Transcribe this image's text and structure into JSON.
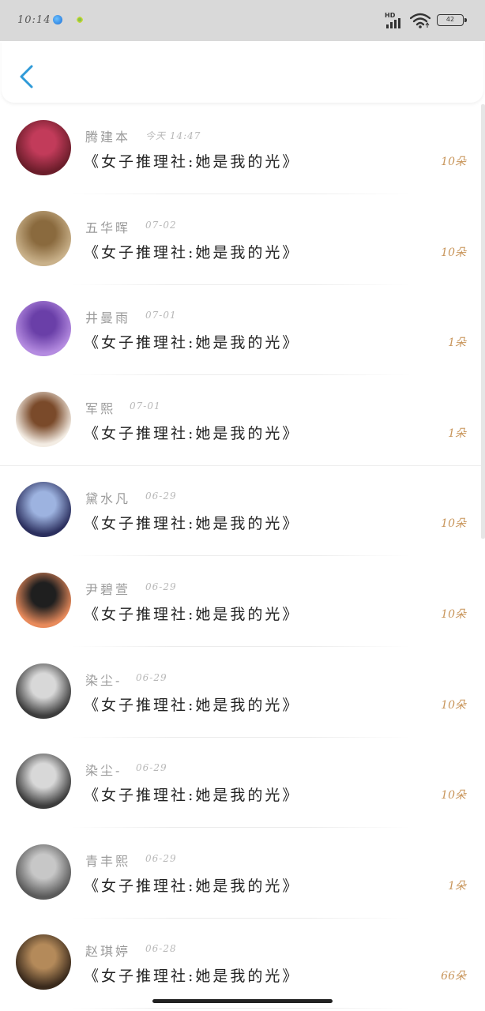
{
  "status_bar": {
    "time": "10:14",
    "network": "HD",
    "battery": "42"
  },
  "gifts": [
    {
      "user": "腾建本",
      "date": "今天 14:47",
      "title": "《女子推理社:她是我的光》",
      "count": "10朵",
      "avatar_colors": [
        "#6b1d2a",
        "#c23b5a"
      ]
    },
    {
      "user": "五华晖",
      "date": "07-02",
      "title": "《女子推理社:她是我的光》",
      "count": "10朵",
      "avatar_colors": [
        "#c9b18a",
        "#8a6a3e"
      ]
    },
    {
      "user": "井曼雨",
      "date": "07-01",
      "title": "《女子推理社:她是我的光》",
      "count": "1朵",
      "avatar_colors": [
        "#b48be0",
        "#6a3fa8"
      ]
    },
    {
      "user": "军熙",
      "date": "07-01",
      "title": "《女子推理社:她是我的光》",
      "count": "1朵",
      "avatar_colors": [
        "#f3ece3",
        "#7a4a2a"
      ]
    },
    {
      "user": "黛水凡",
      "date": "06-29",
      "title": "《女子推理社:她是我的光》",
      "count": "10朵",
      "avatar_colors": [
        "#2b2f5e",
        "#9db3e0"
      ]
    },
    {
      "user": "尹碧萱",
      "date": "06-29",
      "title": "《女子推理社:她是我的光》",
      "count": "10朵",
      "avatar_colors": [
        "#e88a5b",
        "#1f1f1f"
      ]
    },
    {
      "user": "染尘-",
      "date": "06-29",
      "title": "《女子推理社:她是我的光》",
      "count": "10朵",
      "avatar_colors": [
        "#3c3c3c",
        "#d8d8d8"
      ]
    },
    {
      "user": "染尘-",
      "date": "06-29",
      "title": "《女子推理社:她是我的光》",
      "count": "10朵",
      "avatar_colors": [
        "#3c3c3c",
        "#d8d8d8"
      ]
    },
    {
      "user": "青丰熙",
      "date": "06-29",
      "title": "《女子推理社:她是我的光》",
      "count": "1朵",
      "avatar_colors": [
        "#5a5a5a",
        "#c7c7c7"
      ]
    },
    {
      "user": "赵琪婷",
      "date": "06-28",
      "title": "《女子推理社:她是我的光》",
      "count": "66朵",
      "avatar_colors": [
        "#3a2a1c",
        "#b48a5a"
      ]
    }
  ]
}
